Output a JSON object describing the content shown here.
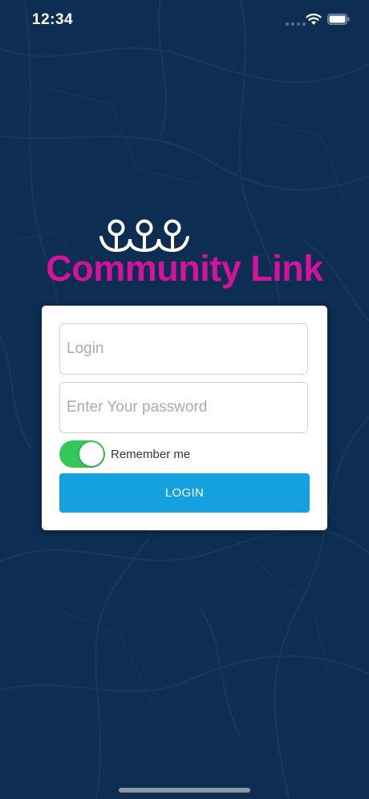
{
  "status_bar": {
    "time": "12:34",
    "icons": [
      "cellular-signal-icon",
      "wifi-icon",
      "battery-icon"
    ]
  },
  "brand": {
    "name": "Community Link",
    "logo_icon": "three-people-icon",
    "brand_color": "#d5139a"
  },
  "login_form": {
    "login_placeholder": "Login",
    "login_value": "",
    "password_placeholder": "Enter Your password",
    "password_value": "",
    "remember_label": "Remember me",
    "remember_on": true,
    "submit_label": "LOGIN"
  },
  "colors": {
    "background": "#0d2d52",
    "toggle_on": "#34c759",
    "button": "#15a0df"
  }
}
